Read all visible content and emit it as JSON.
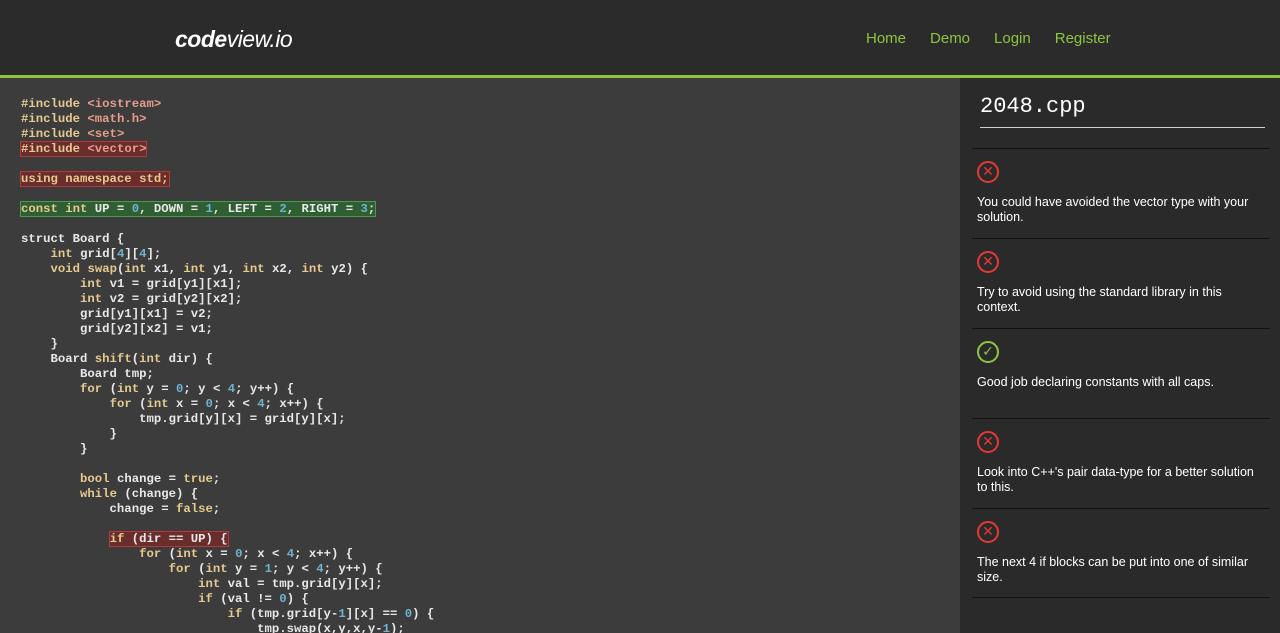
{
  "brand": {
    "part1": "code",
    "part2": "view.io"
  },
  "nav": [
    "Home",
    "Demo",
    "Login",
    "Register"
  ],
  "file": {
    "name": "2048.cpp"
  },
  "colors": {
    "accent": "#8cc63f",
    "error": "#e53935",
    "ok": "#8cc63f"
  },
  "code_lines": [
    {
      "hl": "",
      "tokens": [
        [
          "kw",
          "#include "
        ],
        [
          "str",
          "<iostream>"
        ]
      ]
    },
    {
      "hl": "",
      "tokens": [
        [
          "kw",
          "#include "
        ],
        [
          "str",
          "<math.h>"
        ]
      ]
    },
    {
      "hl": "",
      "tokens": [
        [
          "kw",
          "#include "
        ],
        [
          "str",
          "<set>"
        ]
      ]
    },
    {
      "hl": "red",
      "tokens": [
        [
          "kw",
          "#include "
        ],
        [
          "str",
          "<vector>"
        ]
      ]
    },
    {
      "hl": "",
      "tokens": []
    },
    {
      "hl": "red",
      "tokens": [
        [
          "kw",
          "using namespace std;"
        ]
      ]
    },
    {
      "hl": "",
      "tokens": []
    },
    {
      "hl": "green",
      "tokens": [
        [
          "kw",
          "const int "
        ],
        [
          "pl",
          "UP = "
        ],
        [
          "num",
          "0"
        ],
        [
          "pl",
          ", DOWN = "
        ],
        [
          "num",
          "1"
        ],
        [
          "pl",
          ", LEFT = "
        ],
        [
          "num",
          "2"
        ],
        [
          "pl",
          ", RIGHT = "
        ],
        [
          "num",
          "3"
        ],
        [
          "pl",
          ";"
        ]
      ]
    },
    {
      "hl": "",
      "tokens": []
    },
    {
      "hl": "",
      "tokens": [
        [
          "pl",
          "struct Board {"
        ]
      ]
    },
    {
      "hl": "",
      "tokens": [
        [
          "pl",
          "    "
        ],
        [
          "kw",
          "int "
        ],
        [
          "pl",
          "grid["
        ],
        [
          "num",
          "4"
        ],
        [
          "pl",
          "]["
        ],
        [
          "num",
          "4"
        ],
        [
          "pl",
          "];"
        ]
      ]
    },
    {
      "hl": "",
      "tokens": [
        [
          "pl",
          "    "
        ],
        [
          "kw",
          "void "
        ],
        [
          "fn",
          "swap"
        ],
        [
          "pl",
          "("
        ],
        [
          "kw",
          "int "
        ],
        [
          "pl",
          "x1, "
        ],
        [
          "kw",
          "int "
        ],
        [
          "pl",
          "y1, "
        ],
        [
          "kw",
          "int "
        ],
        [
          "pl",
          "x2, "
        ],
        [
          "kw",
          "int "
        ],
        [
          "pl",
          "y2) {"
        ]
      ]
    },
    {
      "hl": "",
      "tokens": [
        [
          "pl",
          "        "
        ],
        [
          "kw",
          "int "
        ],
        [
          "pl",
          "v1 = grid[y1][x1];"
        ]
      ]
    },
    {
      "hl": "",
      "tokens": [
        [
          "pl",
          "        "
        ],
        [
          "kw",
          "int "
        ],
        [
          "pl",
          "v2 = grid[y2][x2];"
        ]
      ]
    },
    {
      "hl": "",
      "tokens": [
        [
          "pl",
          "        grid[y1][x1] = v2;"
        ]
      ]
    },
    {
      "hl": "",
      "tokens": [
        [
          "pl",
          "        grid[y2][x2] = v1;"
        ]
      ]
    },
    {
      "hl": "",
      "tokens": [
        [
          "pl",
          "    }"
        ]
      ]
    },
    {
      "hl": "",
      "tokens": [
        [
          "pl",
          "    Board "
        ],
        [
          "fn",
          "shift"
        ],
        [
          "pl",
          "("
        ],
        [
          "kw",
          "int "
        ],
        [
          "pl",
          "dir) {"
        ]
      ]
    },
    {
      "hl": "",
      "tokens": [
        [
          "pl",
          "        Board tmp;"
        ]
      ]
    },
    {
      "hl": "",
      "tokens": [
        [
          "pl",
          "        "
        ],
        [
          "kw",
          "for "
        ],
        [
          "pl",
          "("
        ],
        [
          "kw",
          "int "
        ],
        [
          "pl",
          "y = "
        ],
        [
          "num",
          "0"
        ],
        [
          "pl",
          "; y < "
        ],
        [
          "num",
          "4"
        ],
        [
          "pl",
          "; y++) {"
        ]
      ]
    },
    {
      "hl": "",
      "tokens": [
        [
          "pl",
          "            "
        ],
        [
          "kw",
          "for "
        ],
        [
          "pl",
          "("
        ],
        [
          "kw",
          "int "
        ],
        [
          "pl",
          "x = "
        ],
        [
          "num",
          "0"
        ],
        [
          "pl",
          "; x < "
        ],
        [
          "num",
          "4"
        ],
        [
          "pl",
          "; x++) {"
        ]
      ]
    },
    {
      "hl": "",
      "tokens": [
        [
          "pl",
          "                tmp.grid[y][x] = grid[y][x];"
        ]
      ]
    },
    {
      "hl": "",
      "tokens": [
        [
          "pl",
          "            }"
        ]
      ]
    },
    {
      "hl": "",
      "tokens": [
        [
          "pl",
          "        }"
        ]
      ]
    },
    {
      "hl": "",
      "tokens": []
    },
    {
      "hl": "",
      "tokens": [
        [
          "pl",
          "        "
        ],
        [
          "kw",
          "bool "
        ],
        [
          "pl",
          "change = "
        ],
        [
          "kw",
          "true"
        ],
        [
          "pl",
          ";"
        ]
      ]
    },
    {
      "hl": "",
      "tokens": [
        [
          "pl",
          "        "
        ],
        [
          "kw",
          "while "
        ],
        [
          "pl",
          "(change) {"
        ]
      ]
    },
    {
      "hl": "",
      "tokens": [
        [
          "pl",
          "            change = "
        ],
        [
          "kw",
          "false"
        ],
        [
          "pl",
          ";"
        ]
      ]
    },
    {
      "hl": "",
      "tokens": []
    },
    {
      "hl": "red",
      "indent": "            ",
      "tokens": [
        [
          "kw",
          "if "
        ],
        [
          "pl",
          "(dir == UP) {"
        ]
      ]
    },
    {
      "hl": "",
      "tokens": [
        [
          "pl",
          "                "
        ],
        [
          "kw",
          "for "
        ],
        [
          "pl",
          "("
        ],
        [
          "kw",
          "int "
        ],
        [
          "pl",
          "x = "
        ],
        [
          "num",
          "0"
        ],
        [
          "pl",
          "; x < "
        ],
        [
          "num",
          "4"
        ],
        [
          "pl",
          "; x++) {"
        ]
      ]
    },
    {
      "hl": "",
      "tokens": [
        [
          "pl",
          "                    "
        ],
        [
          "kw",
          "for "
        ],
        [
          "pl",
          "("
        ],
        [
          "kw",
          "int "
        ],
        [
          "pl",
          "y = "
        ],
        [
          "num",
          "1"
        ],
        [
          "pl",
          "; y < "
        ],
        [
          "num",
          "4"
        ],
        [
          "pl",
          "; y++) {"
        ]
      ]
    },
    {
      "hl": "",
      "tokens": [
        [
          "pl",
          "                        "
        ],
        [
          "kw",
          "int "
        ],
        [
          "pl",
          "val = tmp.grid[y][x];"
        ]
      ]
    },
    {
      "hl": "",
      "tokens": [
        [
          "pl",
          "                        "
        ],
        [
          "kw",
          "if "
        ],
        [
          "pl",
          "(val != "
        ],
        [
          "num",
          "0"
        ],
        [
          "pl",
          ") {"
        ]
      ]
    },
    {
      "hl": "",
      "tokens": [
        [
          "pl",
          "                            "
        ],
        [
          "kw",
          "if "
        ],
        [
          "pl",
          "(tmp.grid[y-"
        ],
        [
          "num",
          "1"
        ],
        [
          "pl",
          "][x] == "
        ],
        [
          "num",
          "0"
        ],
        [
          "pl",
          ") {"
        ]
      ]
    },
    {
      "hl": "",
      "tokens": [
        [
          "pl",
          "                                tmp.swap(x,y,x,y-"
        ],
        [
          "num",
          "1"
        ],
        [
          "pl",
          ");"
        ]
      ]
    }
  ],
  "comments": [
    {
      "status": "bad",
      "icon": "x-circle-icon",
      "glyph": "✕",
      "text": "You could have avoided the vector type with your solution."
    },
    {
      "status": "bad",
      "icon": "x-circle-icon",
      "glyph": "✕",
      "text": "Try to avoid using the standard library in this context."
    },
    {
      "status": "good",
      "icon": "check-circle-icon",
      "glyph": "✓",
      "text": "Good job declaring constants with all caps."
    },
    {
      "status": "bad",
      "icon": "x-circle-icon",
      "glyph": "✕",
      "text": "Look into C++'s pair data-type for a better solution to this."
    },
    {
      "status": "bad",
      "icon": "x-circle-icon",
      "glyph": "✕",
      "text": "The next 4 if blocks can be put into one of similar size."
    }
  ]
}
